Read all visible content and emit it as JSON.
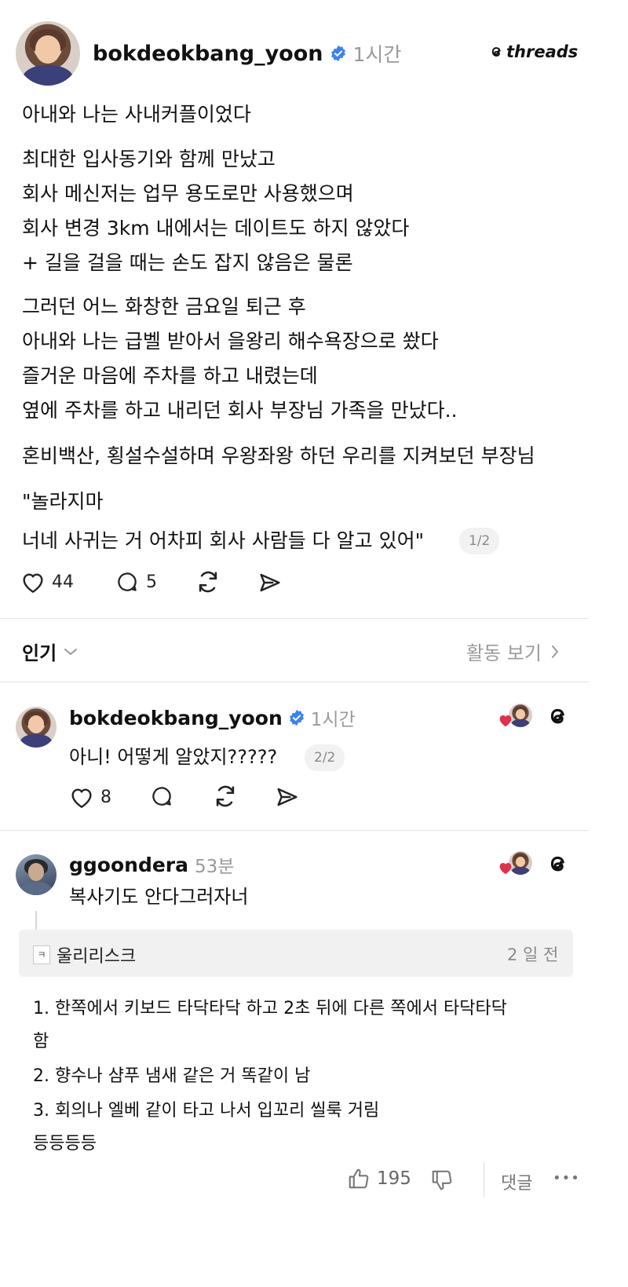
{
  "post": {
    "username": "bokdeokbang_yoon",
    "time": "1시간",
    "brand": "threads",
    "lines": [
      "아내와 나는 사내커플이었다",
      "최대한 입사동기와 함께 만났고",
      "회사 메신저는 업무 용도로만 사용했으며",
      "회사 변경 3km 내에서는 데이트도 하지 않았다",
      " + 길을 걸을 때는 손도 잡지 않음은 물론",
      "그러던 어느 화창한 금요일 퇴근 후",
      "아내와 나는 급벨 받아서 을왕리 해수욕장으로 쐈다",
      "즐거운 마음에 주차를 하고 내렸는데",
      "옆에 주차를 하고 내리던 회사 부장님 가족을 만났다..",
      "혼비백산, 횡설수설하며 우왕좌왕 하던 우리를 지켜보던 부장님",
      "\"놀라지마",
      " 너네 사귀는 거 어차피 회사 사람들 다 알고 있어\""
    ],
    "pager": "1/2",
    "likes": "44",
    "comments": "5"
  },
  "sort": {
    "label": "인기",
    "activity": "활동 보기"
  },
  "reply1": {
    "username": "bokdeokbang_yoon",
    "time": "1시간",
    "text": "아니! 어떻게 알았지?????",
    "pager": "2/2",
    "likes": "8"
  },
  "reply2": {
    "username": "ggoondera",
    "time": "53분",
    "text": "복사기도 안다그러자너"
  },
  "community": {
    "source": "울리리스크",
    "source_badge": "ㅋ",
    "age": "2 일 전",
    "lines": [
      "1. 한쪽에서 키보드 타닥타닥 하고 2초 뒤에 다른 쪽에서 타닥타닥",
      "함",
      "2. 향수나 샴푸 냄새 같은 거 똑같이 남",
      "3. 회의나 엘베 같이 타고 나서 입꼬리 씰룩 거림",
      "등등등등"
    ],
    "likes": "195",
    "comment_label": "댓글",
    "more": "•••"
  },
  "colors": {
    "verified": "#3b82f6",
    "heart_red": "#e0304a",
    "muted": "#9a9a9a"
  }
}
